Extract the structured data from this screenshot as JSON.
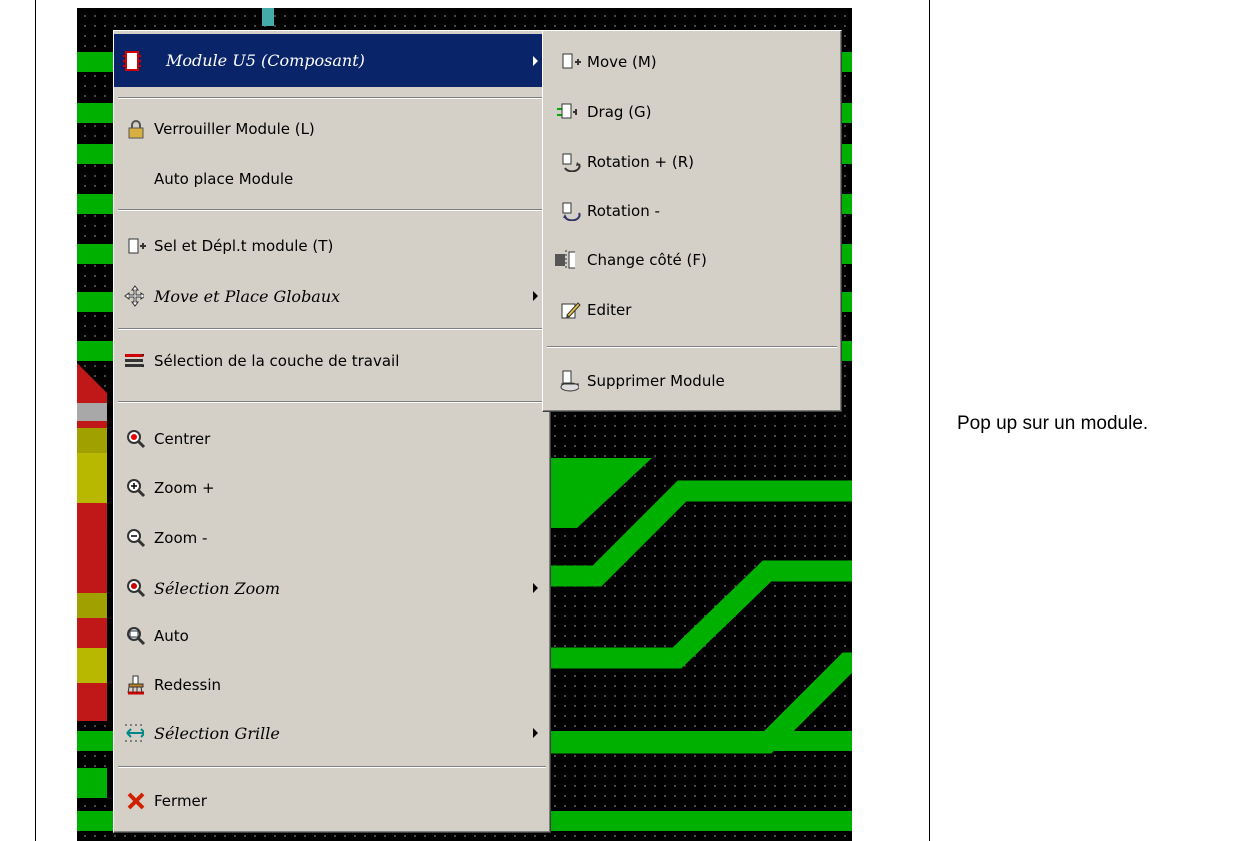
{
  "caption": "Pop up sur un module.",
  "main_menu": {
    "items": [
      {
        "label": "Module U5 (Composant)",
        "icon": "chip-icon",
        "italic": true,
        "submenu": true,
        "highlighted": true
      },
      {
        "label": "Verrouiller Module (L)",
        "icon": "lock-icon"
      },
      {
        "label": "Auto place Module",
        "icon": ""
      },
      {
        "label": "Sel et Dépl.t module (T)",
        "icon": "select-move-icon"
      },
      {
        "label": "Move et Place Globaux",
        "icon": "move-arrows-icon",
        "italic": true,
        "submenu": true
      },
      {
        "label": "Sélection de la couche de travail",
        "icon": "layers-icon"
      },
      {
        "label": "Centrer",
        "icon": "center-icon"
      },
      {
        "label": "Zoom +",
        "icon": "zoom-in-icon"
      },
      {
        "label": "Zoom -",
        "icon": "zoom-out-icon"
      },
      {
        "label": "Sélection Zoom",
        "icon": "zoom-select-icon",
        "italic": true,
        "submenu": true
      },
      {
        "label": "Auto",
        "icon": "zoom-auto-icon"
      },
      {
        "label": "Redessin",
        "icon": "redraw-brush-icon"
      },
      {
        "label": "Sélection Grille",
        "icon": "grid-icon",
        "italic": true,
        "submenu": true
      },
      {
        "label": "Fermer",
        "icon": "close-icon"
      }
    ]
  },
  "sub_menu": {
    "items": [
      {
        "label": "Move (M)",
        "icon": "move-icon"
      },
      {
        "label": "Drag (G)",
        "icon": "drag-icon"
      },
      {
        "label": "Rotation + (R)",
        "icon": "rotate-plus-icon"
      },
      {
        "label": "Rotation -",
        "icon": "rotate-minus-icon"
      },
      {
        "label": "Change côté (F)",
        "icon": "flip-side-icon"
      },
      {
        "label": "Editer",
        "icon": "edit-icon"
      },
      {
        "label": "Supprimer Module",
        "icon": "delete-module-icon"
      }
    ]
  },
  "colors": {
    "trace": "#00b000",
    "menu_bg": "#d4d0c8",
    "highlight": "#0a246a"
  }
}
